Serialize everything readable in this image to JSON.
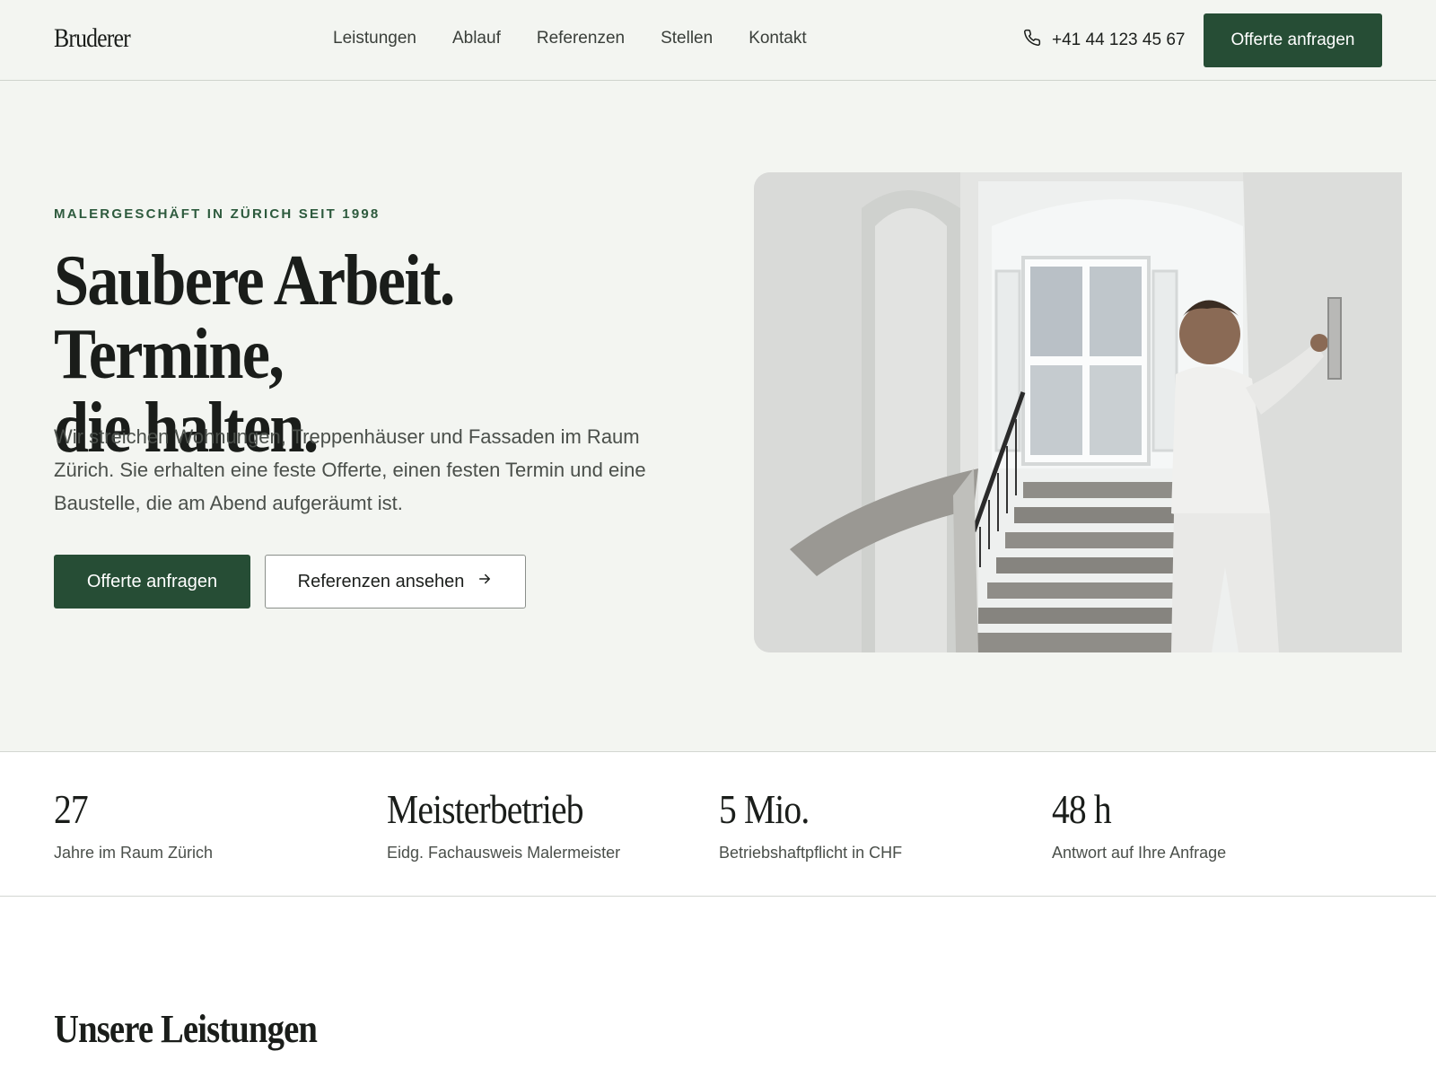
{
  "header": {
    "logo": "Bruderer",
    "nav": [
      "Leistungen",
      "Ablauf",
      "Referenzen",
      "Stellen",
      "Kontakt"
    ],
    "phone": "+41 44 123 45 67",
    "cta": "Offerte anfragen"
  },
  "hero": {
    "eyebrow": "MALERGESCHÄFT IN ZÜRICH SEIT 1998",
    "title_line1": "Saubere Arbeit. Termine,",
    "title_line2": "die halten.",
    "text": "Wir streichen Wohnungen, Treppenhäuser und Fassaden im Raum Zürich. Sie erhalten eine feste Offerte, einen festen Termin und eine Baustelle, die am Abend aufgeräumt ist.",
    "primary_button": "Offerte anfragen",
    "secondary_button": "Referenzen ansehen"
  },
  "stats": [
    {
      "value": "27",
      "label": "Jahre im Raum Zürich"
    },
    {
      "value": "Meisterbetrieb",
      "label": "Eidg. Fachausweis Malermeister"
    },
    {
      "value": "5 Mio.",
      "label": "Betriebshaftpflicht in CHF"
    },
    {
      "value": "48 h",
      "label": "Antwort auf Ihre Anfrage"
    }
  ],
  "services": {
    "title": "Unsere Leistungen"
  },
  "colors": {
    "accent": "#264d35",
    "background": "#f3f5f1",
    "eyebrow": "#2d5a3d"
  }
}
